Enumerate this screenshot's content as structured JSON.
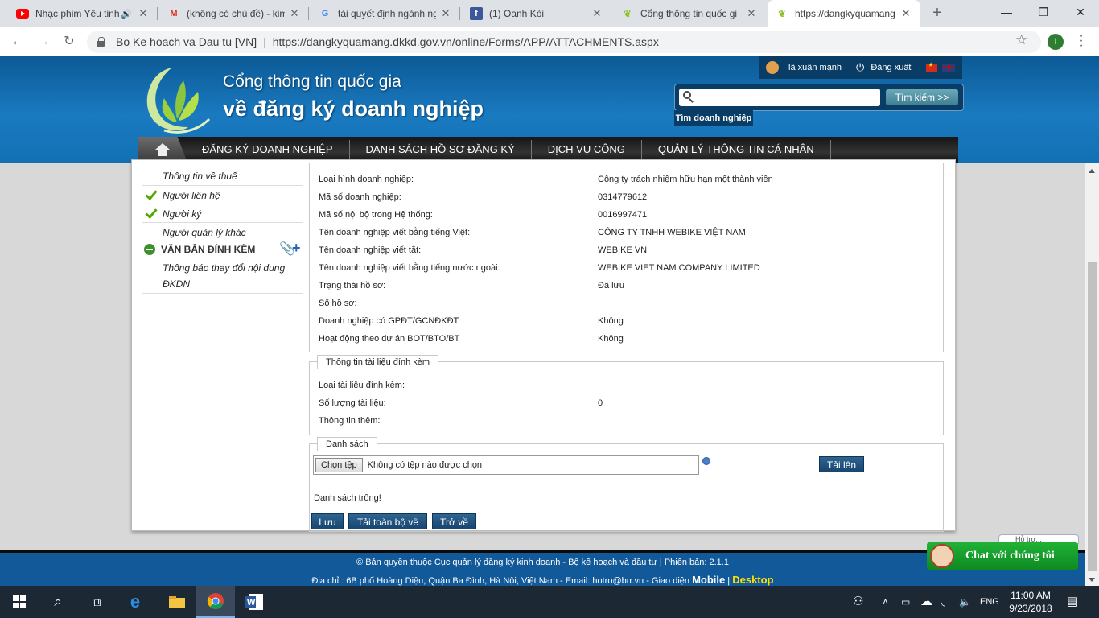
{
  "browser": {
    "tabs": [
      {
        "title": "Nhạc phim Yêu tinh",
        "icon": "youtube-icon",
        "audio": true
      },
      {
        "title": "(không có chủ đề) - kim",
        "icon": "gmail-icon"
      },
      {
        "title": "tải quyết định ngành ng",
        "icon": "google-icon"
      },
      {
        "title": "(1) Oanh Kòi",
        "icon": "facebook-icon"
      },
      {
        "title": "Cổng thông tin quốc gi",
        "icon": "dkkd-leaf-icon"
      },
      {
        "title": "https://dangkyquamang",
        "icon": "dkkd-leaf-icon",
        "active": true
      }
    ],
    "cert_name": "Bo Ke hoach va Dau tu [VN]",
    "url": "https://dangkyquamang.dkkd.gov.vn/online/Forms/APP/ATTACHMENTS.aspx",
    "profile_initial": "I",
    "win_minimize": "—",
    "win_restore": "❐",
    "win_close": "✕"
  },
  "header": {
    "brand_line1": "Cổng thông tin quốc gia",
    "brand_line2": "về đăng ký doanh nghiệp",
    "user_name": "lã xuân mạnh",
    "logout": "Đăng xuất",
    "search_placeholder": "",
    "search_button": "Tìm kiếm >>",
    "search_tab": "Tìm doanh nghiệp",
    "nav": [
      "ĐĂNG KÝ DOANH NGHIỆP",
      "DANH SÁCH HỒ SƠ ĐĂNG KÝ",
      "DỊCH VỤ CÔNG",
      "QUẢN LÝ THÔNG TIN CÁ NHÂN"
    ]
  },
  "sidebar": {
    "items": [
      {
        "label": "Thông tin về thuế",
        "checked": false
      },
      {
        "label": "Người liên hệ",
        "checked": true
      },
      {
        "label": "Người ký",
        "checked": true
      },
      {
        "label": "Người quản lý khác",
        "checked": false
      }
    ],
    "section": "VĂN BẢN ĐÍNH KÈM",
    "subitem_line1": "Thông báo thay đổi nội dung",
    "subitem_line2": "ĐKDN"
  },
  "company_info": [
    {
      "label": "Loại hình doanh nghiệp:",
      "value": "Công ty trách nhiệm hữu hạn một thành viên"
    },
    {
      "label": "Mã số doanh nghiệp:",
      "value": "0314779612"
    },
    {
      "label": "Mã số nội bộ trong Hệ thống:",
      "value": "0016997471"
    },
    {
      "label": "Tên doanh nghiệp viết bằng tiếng Việt:",
      "value": "CÔNG TY TNHH WEBIKE VIỆT NAM"
    },
    {
      "label": "Tên doanh nghiệp viết tắt:",
      "value": "WEBIKE VN"
    },
    {
      "label": "Tên doanh nghiệp viết bằng tiếng nước ngoài:",
      "value": "WEBIKE VIET NAM COMPANY LIMITED"
    },
    {
      "label": "Trạng thái hồ sơ:",
      "value": "Đã lưu"
    },
    {
      "label": "Số hồ sơ:",
      "value": ""
    },
    {
      "label": "Doanh nghiệp có GPĐT/GCNĐKĐT",
      "value": "Không"
    },
    {
      "label": "Hoạt động theo dự án BOT/BTO/BT",
      "value": "Không"
    }
  ],
  "attachment_info": {
    "legend": "Thông tin tài liệu đính kèm",
    "rows": [
      {
        "label": "Loại tài liệu đính kèm:",
        "value": ""
      },
      {
        "label": "Số lượng tài liệu:",
        "value": "0"
      },
      {
        "label": "Thông tin thêm:",
        "value": ""
      }
    ]
  },
  "list_section": {
    "legend": "Danh sách",
    "choose_file": "Chọn tệp",
    "no_file": "Không có tệp nào được chọn",
    "upload": "Tải lên",
    "empty": "Danh sách trống!",
    "save": "Lưu",
    "download_all": "Tải toàn bộ về",
    "back": "Trở về"
  },
  "footer": {
    "line1": "© Bản quyền thuộc Cục quản lý đăng ký kinh doanh - Bộ kế hoạch và đầu tư | Phiên bản: 2.1.1",
    "line2_prefix": "Địa chỉ : 6B phố Hoàng Diệu, Quận Ba Đình, Hà Nội, Việt Nam - Email: ",
    "email": "hotro@brr.vn",
    "line2_mid": " - Giao diện ",
    "mobile": "Mobile",
    "sep": " | ",
    "desktop": "Desktop"
  },
  "chat": {
    "label": "Chat với chúng tôi",
    "peek": "Hỗ trợ..."
  },
  "taskbar": {
    "lang": "ENG",
    "time": "11:00 AM",
    "date": "9/23/2018"
  }
}
